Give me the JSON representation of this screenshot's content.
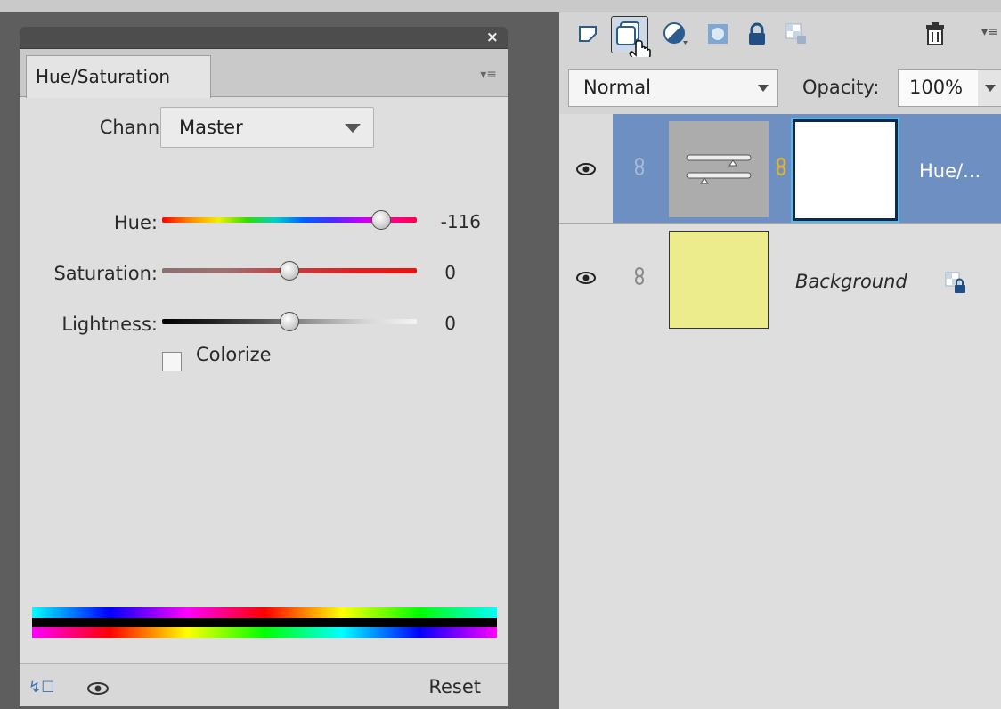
{
  "adjustment_panel": {
    "tab_label": "Hue/Saturation",
    "close_glyph": "×",
    "menu_glyph": "▾≡",
    "channel_label": "Channel:",
    "channel_value": "Master",
    "hue_label": "Hue:",
    "hue_value": "-116",
    "hue_level": 0.86,
    "saturation_label": "Saturation:",
    "saturation_value": "0",
    "saturation_level": 0.5,
    "lightness_label": "Lightness:",
    "lightness_value": "0",
    "lightness_level": 0.5,
    "colorize_label": "Colorize",
    "colorize_checked": false,
    "reset_label": "Reset"
  },
  "layers_panel": {
    "blend_mode": "Normal",
    "opacity_label": "Opacity:",
    "opacity_value": "100%",
    "toolbar_icons": [
      "new-layer-icon",
      "new-group-icon",
      "adjustment-layer-icon",
      "layer-mask-icon",
      "lock-all-icon",
      "lock-transparency-icon",
      "trash-icon",
      "panel-menu-icon"
    ],
    "layers": [
      {
        "name": "Hue/...",
        "type": "adjustment",
        "selected": true
      },
      {
        "name": "Background",
        "type": "image",
        "selected": false,
        "locked": true,
        "fill_color": "#ecec8c"
      }
    ]
  },
  "colors": {
    "selection": "#6d8fc2",
    "panel_bg": "#dedede",
    "dark_frame": "#5e5e5e"
  }
}
